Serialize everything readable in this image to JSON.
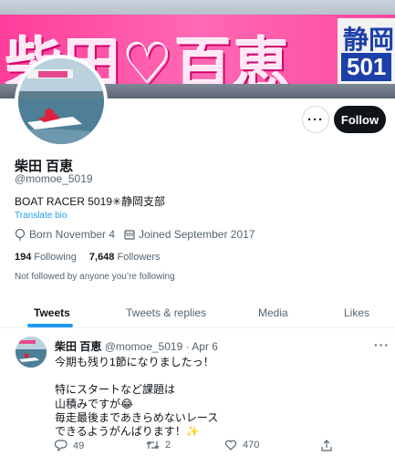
{
  "banner": {
    "main_text": "柴田♡百恵",
    "side_top": "静岡",
    "side_bottom": "501"
  },
  "profile": {
    "name": "柴田 百恵",
    "handle": "@momoe_5019",
    "bio": "BOAT RACER 5019✳︎静岡支部",
    "translate": "Translate bio",
    "born": "Born November 4",
    "joined": "Joined September 2017",
    "following_count": "194",
    "following_label": "Following",
    "followers_count": "7,648",
    "followers_label": "Followers",
    "not_followed": "Not followed by anyone you’re following",
    "follow_label": "Follow",
    "more_label": "···"
  },
  "tabs": [
    {
      "label": "Tweets"
    },
    {
      "label": "Tweets & replies"
    },
    {
      "label": "Media"
    },
    {
      "label": "Likes"
    }
  ],
  "tweet": {
    "name": "柴田 百恵",
    "handle": "@momoe_5019",
    "date": "· Apr 6",
    "more": "···",
    "lines": [
      "今期も残り1節になりましたっ！",
      "特にスタートなど課題は",
      "山積みですが😂",
      "毎走最後まであきらめないレース",
      "できるようがんばります！✨"
    ],
    "replies": "49",
    "retweets": "2",
    "likes": "470"
  },
  "colors": {
    "accent": "#1d9bf0",
    "text": "#0f1419",
    "secondary": "#536471",
    "banner_pink": "#ff69b4"
  }
}
